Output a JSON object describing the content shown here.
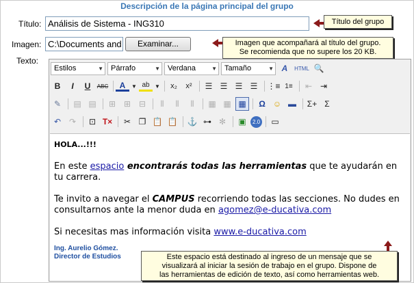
{
  "heading": "Descripción de la página principal del grupo",
  "form": {
    "titulo_label": "Título:",
    "titulo_value": "Análisis de Sistema  - ING310",
    "imagen_label": "Imagen:",
    "imagen_value": "C:\\Documents and",
    "examinar_label": "Examinar...",
    "texto_label": "Texto:"
  },
  "callouts": {
    "titulo": "Título del grupo",
    "imagen_line1": "Imagen que acompañará al título del grupo.",
    "imagen_line2": "Se recomienda que no supere los 20 KB.",
    "texto_line1": "Este espacio está destinado al ingreso de un mensaje que se",
    "texto_line2": "visualizará al iniciar la sesión de trabajo en el grupo. Dispone de",
    "texto_line3": "las herramientas de edición de texto, así como herramientas web."
  },
  "toolbar": {
    "styles": "Estilos",
    "paragraph": "Párrafo",
    "font": "Verdana",
    "size": "Tamaño",
    "html": "HTML"
  },
  "content": {
    "greeting": "HOLA...!!!",
    "p1_a": "En este ",
    "p1_link": "espacio",
    "p1_b": " encontrarás todas las herramientas",
    "p1_c": " que te ayudarán en tu carrera.",
    "p2_a": "Te invito a navegar el ",
    "p2_b": "CAMPUS",
    "p2_c": " recorriendo todas las secciones. No dudes en consultarnos ante la menor duda en ",
    "p2_link": "agomez@e-ducativa.com",
    "p3_a": "Si necesitas mas información visita ",
    "p3_link": "www.e-ducativa.com",
    "sig1": "Ing. Aurelio Gómez.",
    "sig2": "Director de Estudios"
  }
}
